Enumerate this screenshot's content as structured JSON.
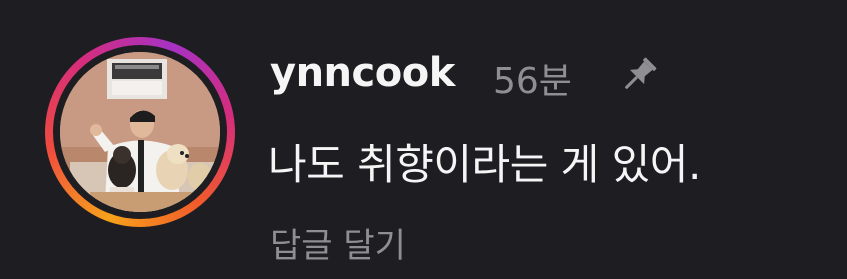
{
  "comment": {
    "username": "ynncook",
    "time": "56분",
    "text": "나도 취향이라는 게 있어.",
    "reply_label": "답글 달기",
    "pinned": true
  },
  "icons": {
    "pin": "pin-icon"
  },
  "colors": {
    "background": "#1e1e22",
    "text_primary": "#f5f5f5",
    "text_secondary": "#8e8e93",
    "story_ring_start": "#f7a21b",
    "story_ring_end": "#a632c4"
  }
}
